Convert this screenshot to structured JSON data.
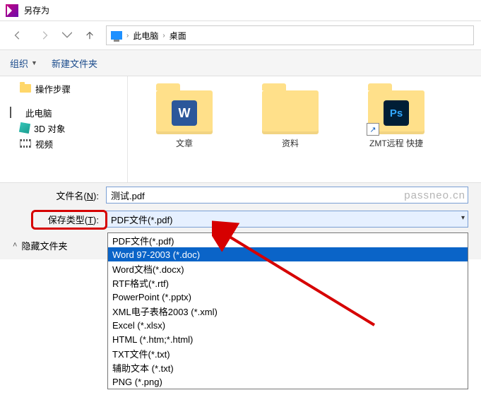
{
  "window": {
    "title": "另存为"
  },
  "nav": {
    "crumbs": [
      "此电脑",
      "桌面"
    ]
  },
  "toolbar": {
    "organize": "组织",
    "newfolder": "新建文件夹"
  },
  "tree": {
    "steps": "操作步骤",
    "pc": "此电脑",
    "threed": "3D 对象",
    "video": "视频"
  },
  "files": {
    "f1": "文章",
    "f2": "资料",
    "f3": "ZMT远程  快捷"
  },
  "form": {
    "filename_label_pre": "文件名(",
    "filename_key": "N",
    "filename_label_post": "):",
    "filetype_label_pre": "保存类型(",
    "filetype_key": "T",
    "filetype_label_post": "):",
    "filename_value": "测试.pdf",
    "filetype_value": "PDF文件(*.pdf)",
    "hide": "隐藏文件夹"
  },
  "options": [
    "PDF文件(*.pdf)",
    "Word 97-2003 (*.doc)",
    "Word文档(*.docx)",
    "RTF格式(*.rtf)",
    "PowerPoint (*.pptx)",
    "XML电子表格2003 (*.xml)",
    "Excel (*.xlsx)",
    "HTML (*.htm;*.html)",
    "TXT文件(*.txt)",
    "辅助文本 (*.txt)",
    "PNG (*.png)"
  ],
  "selected_index": 1,
  "watermark": "passneo.cn"
}
